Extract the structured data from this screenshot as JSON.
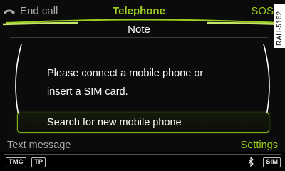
{
  "top_bar": {
    "left_label": "End call",
    "title": "Telephone",
    "right_label": "SOS"
  },
  "note": {
    "title": "Note",
    "message_line1": "Please connect a mobile phone or",
    "message_line2": "insert a SIM card."
  },
  "search_button": {
    "label": "Search for new mobile phone"
  },
  "soft_keys": {
    "left": "Text message",
    "right": "Settings"
  },
  "status_bar": {
    "tmc": "TMC",
    "tp": "TP",
    "sim": "SIM",
    "bluetooth_icon": "bluetooth-icon"
  },
  "ref_code": "RAH-5162",
  "colors": {
    "accent": "#9ccf1f",
    "inactive": "#a9a9a9",
    "background": "#0b0b0b"
  }
}
